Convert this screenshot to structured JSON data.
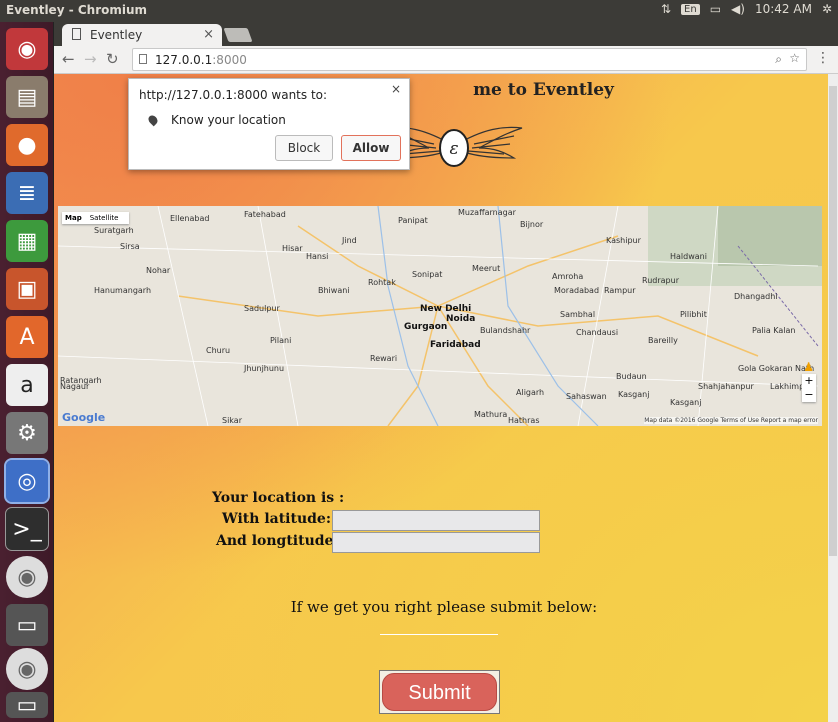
{
  "topbar": {
    "title": "Eventley - Chromium",
    "lang": "En",
    "time": "10:42 AM"
  },
  "browser": {
    "tab_title": "Eventley",
    "url_host": "127.0.0.1",
    "url_port": ":8000"
  },
  "page": {
    "heading": "me to Eventley",
    "location_label": "Your location is :",
    "latitude_label": "With latitude:",
    "longitude_label": "And longtitude:",
    "latitude_value": "",
    "longitude_value": "",
    "prompt": "If we get you right please submit below:",
    "submit_label": "Submit"
  },
  "map": {
    "type_map": "Map",
    "type_satellite": "Satellite",
    "google": "Google",
    "footer": "Map data ©2016 Google   Terms of Use   Report a map error",
    "places": {
      "p1": "Fatehabad",
      "p2": "Ellenabad",
      "p3": "Panipat",
      "p4": "Muzaffarnagar",
      "p5": "Bijnor",
      "p6": "Kashipur",
      "p7": "Hisar",
      "p8": "Jind",
      "p9": "Hansi",
      "p10": "Rohtak",
      "p11": "Sonipat",
      "p12": "Meerut",
      "p13": "Amroha",
      "p14": "Moradabad",
      "p15": "Rampur",
      "p16": "Rudrapur",
      "p17": "Bhiwani",
      "p18": "New Delhi",
      "p19": "Noida",
      "p20": "Gurgaon",
      "p21": "Bulandshahr",
      "p22": "Sambhal",
      "p23": "Pilibhit",
      "p24": "Faridabad",
      "p25": "Chandausi",
      "p26": "Bareilly",
      "p27": "Churu",
      "p28": "Pilani",
      "p29": "Sadulpur",
      "p30": "Jhunjhunu",
      "p31": "Rewari",
      "p32": "Aligarh",
      "p33": "Budaun",
      "p34": "Gola Gokaran Nath",
      "p35": "Lakhimpur",
      "p36": "Nagaur",
      "p37": "Sikar",
      "p38": "Mathura",
      "p39": "Kasganj",
      "p40": "Sahaswan",
      "p41": "Suratgarh",
      "p42": "Hanumangarh",
      "p43": "Nohar",
      "p44": "Ratangarh",
      "p45": "Dhangadhi",
      "p46": "Haldwani",
      "p47": "Sirsa",
      "p48": "Kasganj",
      "p49": "Palia Kalan",
      "p50": "Hathras",
      "p51": "Shahjahanpur"
    }
  },
  "popup": {
    "message": "http://127.0.0.1:8000 wants to:",
    "permission": "Know your location",
    "block": "Block",
    "allow": "Allow",
    "close": "×"
  },
  "colors": {
    "submit": "#d9635b",
    "allow_border": "#e2725b",
    "bg_orange": "#f49456",
    "bg_yellow": "#f7c84c"
  }
}
